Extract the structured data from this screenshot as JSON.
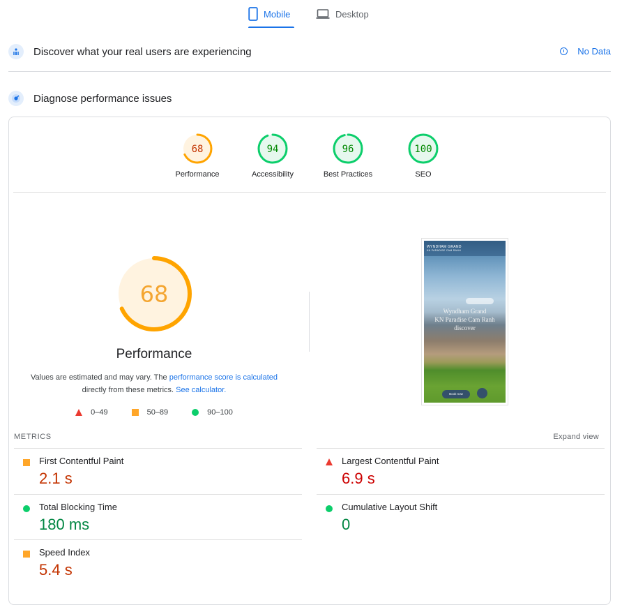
{
  "tabs": [
    {
      "label": "Mobile",
      "icon": "smartphone-icon",
      "active": true
    },
    {
      "label": "Desktop",
      "icon": "laptop-icon",
      "active": false
    }
  ],
  "crux": {
    "title": "Discover what your real users are experiencing",
    "icon": "crux-users-icon",
    "status_label": "No Data",
    "status_icon": "info-icon"
  },
  "diagnose": {
    "title": "Diagnose performance issues",
    "icon": "lighthouse-icon"
  },
  "colors": {
    "accent": "#1a73e8",
    "average": "#ffa400",
    "average_text": "#c33300",
    "pass": "#0cce6b",
    "pass_text": "#018642",
    "fail": "#ff4e42",
    "fail_text": "#cc0000"
  },
  "categories": [
    {
      "label": "Performance",
      "score": 68,
      "rating": "average"
    },
    {
      "label": "Accessibility",
      "score": 94,
      "rating": "pass"
    },
    {
      "label": "Best Practices",
      "score": 96,
      "rating": "pass"
    },
    {
      "label": "SEO",
      "score": 100,
      "rating": "pass"
    }
  ],
  "performance": {
    "score": 68,
    "title": "Performance",
    "desc_prefix": "Values are estimated and may vary. The ",
    "desc_link1": "performance score is calculated",
    "desc_mid": " directly from these metrics. ",
    "desc_link2": "See calculator.",
    "legend": [
      {
        "range": "0–49",
        "shape": "triangle",
        "rating": "fail"
      },
      {
        "range": "50–89",
        "shape": "square",
        "rating": "average"
      },
      {
        "range": "90–100",
        "shape": "circle",
        "rating": "pass"
      }
    ]
  },
  "screenshot": {
    "brand": "WYNDHAM GRAND",
    "brand_sub": "KN PARADISE CAM RANH",
    "headline_1": "Wyndham Grand",
    "headline_2": "KN Paradise Cam Ranh",
    "headline_3": "discover",
    "book_label": "Book now"
  },
  "metrics": {
    "section_label": "METRICS",
    "expand_label": "Expand view",
    "items": [
      {
        "name": "First Contentful Paint",
        "value": "2.1 s",
        "rating": "average"
      },
      {
        "name": "Largest Contentful Paint",
        "value": "6.9 s",
        "rating": "fail"
      },
      {
        "name": "Total Blocking Time",
        "value": "180 ms",
        "rating": "pass"
      },
      {
        "name": "Cumulative Layout Shift",
        "value": "0",
        "rating": "pass"
      },
      {
        "name": "Speed Index",
        "value": "5.4 s",
        "rating": "average"
      }
    ]
  }
}
